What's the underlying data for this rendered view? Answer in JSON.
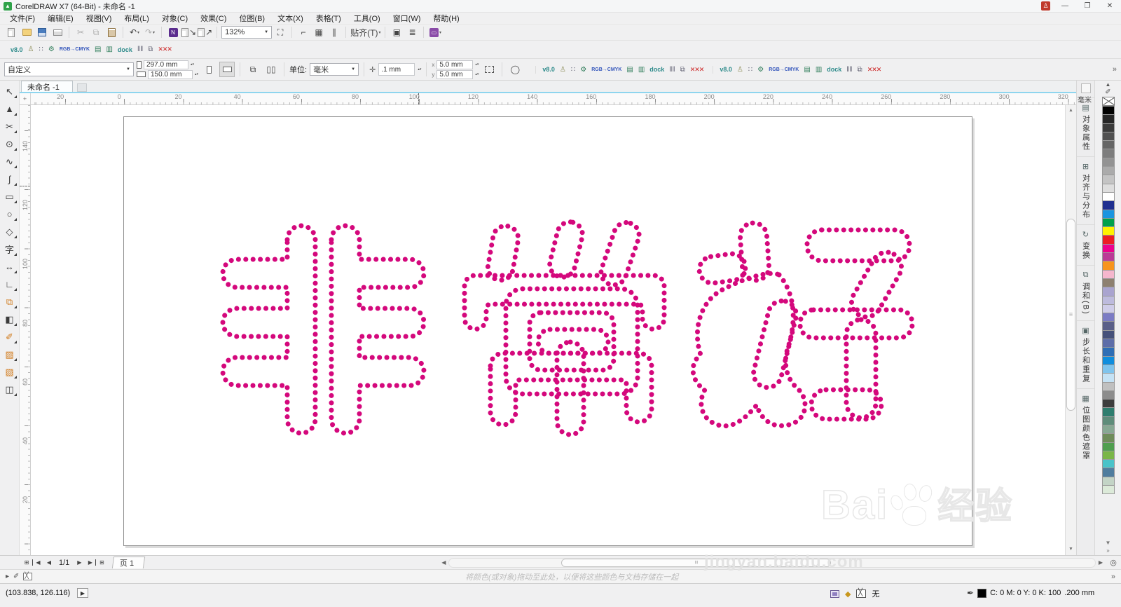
{
  "window": {
    "title": "CorelDRAW X7 (64-Bit) - 未命名 -1"
  },
  "menu": {
    "items": [
      "文件(F)",
      "编辑(E)",
      "视图(V)",
      "布局(L)",
      "对象(C)",
      "效果(C)",
      "位图(B)",
      "文本(X)",
      "表格(T)",
      "工具(O)",
      "窗口(W)",
      "帮助(H)"
    ]
  },
  "toolbar": {
    "zoom_value": "132%",
    "snap_label": "贴齐(T)"
  },
  "plugin_cluster": {
    "items": [
      {
        "glyph": "v8.0",
        "name": "version",
        "cls": "teal"
      },
      {
        "glyph": "♙",
        "name": "people",
        "cls": "olive"
      },
      {
        "glyph": "∷",
        "name": "distribute",
        "cls": "gray"
      },
      {
        "glyph": "⚙",
        "name": "settings",
        "cls": "green"
      },
      {
        "glyph": "RGB→CMYK",
        "name": "rgb-cmyk",
        "cls": "rgb"
      },
      {
        "glyph": "▤",
        "name": "document",
        "cls": "green"
      },
      {
        "glyph": "▥",
        "name": "clipboard",
        "cls": "green"
      },
      {
        "glyph": "dock",
        "name": "dock",
        "cls": "teal"
      },
      {
        "glyph": "‖‖",
        "name": "pins",
        "cls": "gray"
      },
      {
        "glyph": "⧉",
        "name": "layers",
        "cls": "gray"
      },
      {
        "glyph": "✕✕✕",
        "name": "xxx",
        "cls": "red"
      }
    ]
  },
  "property_bar": {
    "preset": "自定义",
    "page_width": "297.0 mm",
    "page_height": "150.0 mm",
    "units_label": "单位:",
    "units_value": "毫米",
    "nudge_value": ".1 mm",
    "dup_x": "5.0 mm",
    "dup_y": "5.0 mm"
  },
  "document": {
    "tab_label": "未命名 -1",
    "page_tab": "页 1",
    "page_indicator": "1/1"
  },
  "rulers": {
    "unit_suffix": "毫米",
    "h_labels": [
      "20",
      "0",
      "20",
      "40",
      "60",
      "80",
      "100",
      "120",
      "140",
      "160",
      "180",
      "200",
      "220",
      "240",
      "260",
      "280",
      "300",
      "320"
    ],
    "v_labels": [
      "140",
      "120",
      "100",
      "80",
      "60",
      "40",
      "20"
    ]
  },
  "canvas": {
    "art_text": "非常好",
    "dot_color": "#d4087c"
  },
  "watermark": {
    "brand_left": "Bai",
    "brand_right": "du",
    "brand_cn": "经验",
    "url": "jingyan.baidu.com"
  },
  "toolbox": {
    "tools": [
      {
        "glyph": "↖",
        "name": "pick"
      },
      {
        "glyph": "▲",
        "name": "shape"
      },
      {
        "glyph": "✂",
        "name": "crop"
      },
      {
        "glyph": "⊙",
        "name": "zoom"
      },
      {
        "glyph": "∿",
        "name": "freehand"
      },
      {
        "glyph": "∫",
        "name": "artistic-media"
      },
      {
        "glyph": "▭",
        "name": "rectangle"
      },
      {
        "glyph": "○",
        "name": "ellipse"
      },
      {
        "glyph": "◇",
        "name": "polygon"
      },
      {
        "glyph": "字",
        "name": "text"
      },
      {
        "glyph": "↔",
        "name": "dimension"
      },
      {
        "glyph": "∟",
        "name": "connector"
      },
      {
        "glyph": "⧉",
        "name": "blend",
        "cls": "orange"
      },
      {
        "glyph": "◧",
        "name": "transparency"
      },
      {
        "glyph": "✐",
        "name": "eyedropper",
        "cls": "orange"
      },
      {
        "glyph": "▨",
        "name": "fill",
        "cls": "orange"
      },
      {
        "glyph": "▧",
        "name": "interactive-fill",
        "cls": "orange"
      },
      {
        "glyph": "◫",
        "name": "outline"
      }
    ]
  },
  "dockers": {
    "tabs": [
      {
        "glyph": "▤",
        "label": "对象属性"
      },
      {
        "glyph": "⊞",
        "label": "对齐与分布"
      },
      {
        "glyph": "↻",
        "label": "变换"
      },
      {
        "glyph": "⧉",
        "label": "调和(B)"
      },
      {
        "glyph": "▣",
        "label": "步长和重复"
      },
      {
        "glyph": "▦",
        "label": "位图颜色遮罩"
      }
    ]
  },
  "palette": {
    "colors": [
      "#000000",
      "#262626",
      "#3b3b3b",
      "#515151",
      "#666666",
      "#7d7d7d",
      "#939393",
      "#ababab",
      "#c4c4c4",
      "#dedede",
      "#ffffff",
      "#1f2f8f",
      "#1b95e0",
      "#00a14b",
      "#fff200",
      "#ed1c24",
      "#ec008c",
      "#bb3a96",
      "#f7941d",
      "#f5b6cd",
      "#8d8070",
      "#a9a4cf",
      "#bdbbdd",
      "#cfcde9",
      "#7b7bc4",
      "#5a5f88",
      "#46517a",
      "#5d6da8",
      "#2e6eb5",
      "#0f8ddd",
      "#7fc4ed",
      "#c4e2f5",
      "#c0c0c0",
      "#8c8c8c",
      "#3d3d3d",
      "#2e7d6e",
      "#5e8c7a",
      "#87a893",
      "#6e8c5a",
      "#4f9e4f",
      "#7ab648",
      "#49c3c9",
      "#4f7d9e",
      "#c3d4c6",
      "#dcead9"
    ]
  },
  "status": {
    "coords": "(103.838, 126.116)",
    "hint": "将颜色(或对象)拖动至此处，以便将这些颜色与文档存储在一起",
    "fill_label": "无",
    "outline_values": "C: 0 M: 0 Y: 0 K: 100",
    "outline_width": ".200 mm"
  }
}
